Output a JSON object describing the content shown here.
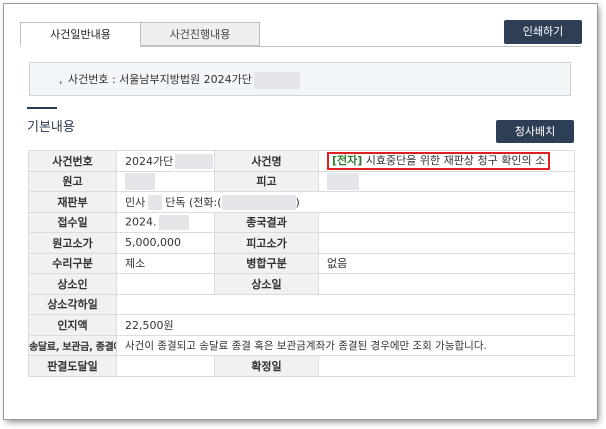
{
  "tabs": [
    {
      "label": "사건일반내용",
      "active": true
    },
    {
      "label": "사건진행내용",
      "active": false
    }
  ],
  "print_button": "인쇄하기",
  "case_summary": {
    "bullet": ",",
    "text": "사건번호 : 서울남부지방법원 2024가단"
  },
  "section": {
    "title": "기본내용",
    "button": "청사배치"
  },
  "rows": {
    "case_no_label": "사건번호",
    "case_no_value": "2024가단",
    "case_name_label": "사건명",
    "case_name_tag": "[전자]",
    "case_name_value": " 시효중단을 위한 재판상 청구 확인의 소",
    "plaintiff_label": "원고",
    "defendant_label": "피고",
    "division_label": "재판부",
    "division_value_a": "민사",
    "division_value_b": "단독 (전화:(",
    "division_value_c": ")",
    "receipt_date_label": "접수일",
    "receipt_date_value": "2024.",
    "final_result_label": "종국결과",
    "plaintiff_amount_label": "원고소가",
    "plaintiff_amount_value": "5,000,000",
    "defendant_amount_label": "피고소가",
    "acceptance_label": "수리구분",
    "acceptance_value": "제소",
    "merge_label": "병합구분",
    "merge_value": "없음",
    "appellant_label": "상소인",
    "appeal_date_label": "상소일",
    "appeal_dismiss_label": "상소각하일",
    "stamp_fee_label": "인지액",
    "stamp_fee_value": "22,500원",
    "balance_label": "송달료, 보관금, 종결에 따른 잔액조회",
    "balance_value": "사건이 종결되고 송달료 종결 혹은 보관금계좌가 종결된 경우에만 조회 가능합니다.",
    "judgment_delivery_label": "판결도달일",
    "finalized_label": "확정일"
  },
  "colors": {
    "button_bg": "#2e3e55",
    "highlight_border": "#e02020",
    "tag_green": "#2d7a2d"
  }
}
